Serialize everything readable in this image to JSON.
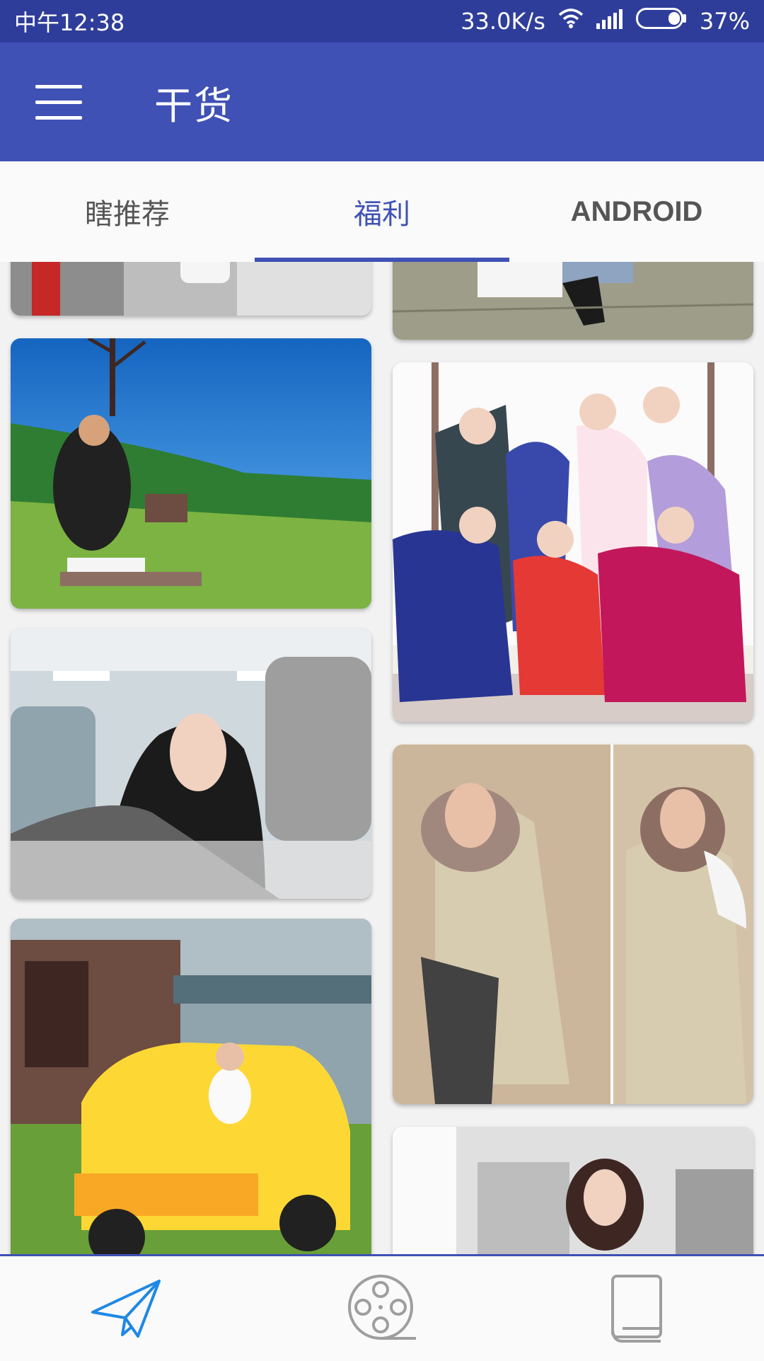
{
  "status_bar": {
    "time": "中午12:38",
    "speed": "33.0K/s",
    "battery": "37%",
    "icons": [
      "wifi-icon",
      "signal-icon",
      "battery-icon"
    ]
  },
  "app_bar": {
    "title": "干货",
    "menu_icon": "menu-icon"
  },
  "tabs": [
    {
      "label": "瞎推荐",
      "active": false
    },
    {
      "label": "福利",
      "active": true
    },
    {
      "label": "ANDROID",
      "active": false
    }
  ],
  "bottom_nav": {
    "items": [
      {
        "icon": "send-icon",
        "active": true
      },
      {
        "icon": "film-reel-icon",
        "active": false
      },
      {
        "icon": "book-icon",
        "active": false
      }
    ]
  },
  "colors": {
    "primary": "#3f51b5",
    "primary_dark": "#2f3d9a",
    "accent_icon": "#1e88e5",
    "inactive_icon": "#9e9e9e"
  }
}
